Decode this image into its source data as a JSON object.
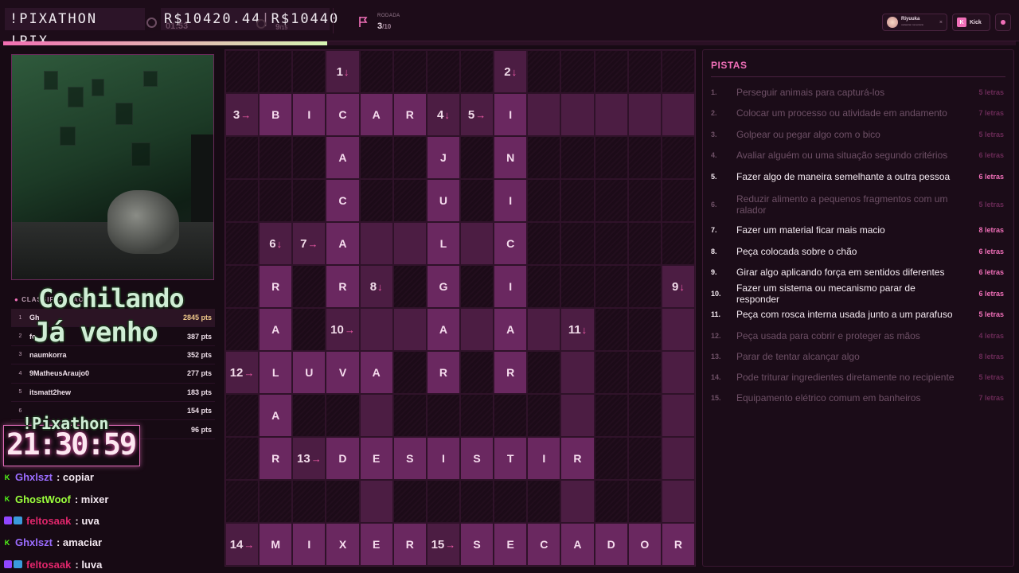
{
  "header": {
    "title": "!PIXATHON !PIX",
    "prize": "R$10420.44",
    "prize_separator": "|",
    "prize_goal": "R$10440",
    "timer": "01:53",
    "count": "9",
    "count_total": "/15",
    "round_label": "RODADA",
    "round_value": "3",
    "round_total": "/10",
    "progress": 0.32,
    "streamer_name": "Riyuuka",
    "streamer_sub": "cadastrar comentário",
    "platform_label": "Kick"
  },
  "webcam": {
    "status_line1": "Cochilando",
    "status_line2": "Já venho"
  },
  "leaderboard": {
    "title": "CLASSIFICAÇÃO",
    "rows": [
      {
        "rank": "1",
        "name": "Gh",
        "points": "2845 pts"
      },
      {
        "rank": "2",
        "name": "fe",
        "points": "387 pts"
      },
      {
        "rank": "3",
        "name": "naumkorra",
        "points": "352 pts"
      },
      {
        "rank": "4",
        "name": "9MatheusAraujo0",
        "points": "277 pts"
      },
      {
        "rank": "5",
        "name": "itsmatt2hew",
        "points": "183 pts"
      },
      {
        "rank": "6",
        "name": "",
        "points": "154 pts"
      },
      {
        "rank": "7",
        "name": "",
        "points": "96 pts"
      }
    ]
  },
  "overlay": {
    "pix_label": "!Pixathon",
    "clock": "21:30:59"
  },
  "chat": [
    {
      "platform": "kick",
      "user": "Ghxlszt",
      "msg": ": copiar",
      "color": "#9b6cff"
    },
    {
      "platform": "kick",
      "user": "GhostWoof",
      "msg": ": mixer",
      "color": "#9bff3c"
    },
    {
      "platform": "twitch",
      "user": "feltosaak",
      "msg": ": uva",
      "color": "#e0266b"
    },
    {
      "platform": "kick",
      "user": "Ghxlszt",
      "msg": ": amaciar",
      "color": "#9b6cff"
    },
    {
      "platform": "twitch",
      "user": "feltosaak",
      "msg": ": luva",
      "color": "#e0266b"
    }
  ],
  "grid": {
    "cols": 14,
    "rows": 12,
    "cells": [
      {
        "r": 0,
        "c": 3,
        "t": "num",
        "n": "1",
        "d": "↓"
      },
      {
        "r": 0,
        "c": 8,
        "t": "num",
        "n": "2",
        "d": "↓"
      },
      {
        "r": 1,
        "c": 0,
        "t": "num",
        "n": "3",
        "d": "→"
      },
      {
        "r": 1,
        "c": 1,
        "t": "letter",
        "v": "B"
      },
      {
        "r": 1,
        "c": 2,
        "t": "letter",
        "v": "I"
      },
      {
        "r": 1,
        "c": 3,
        "t": "letter",
        "v": "C"
      },
      {
        "r": 1,
        "c": 4,
        "t": "letter",
        "v": "A"
      },
      {
        "r": 1,
        "c": 5,
        "t": "letter",
        "v": "R"
      },
      {
        "r": 1,
        "c": 6,
        "t": "num",
        "n": "4",
        "d": "↓"
      },
      {
        "r": 1,
        "c": 7,
        "t": "num",
        "n": "5",
        "d": "→"
      },
      {
        "r": 1,
        "c": 8,
        "t": "letter",
        "v": "I"
      },
      {
        "r": 1,
        "c": 9,
        "t": "open"
      },
      {
        "r": 1,
        "c": 10,
        "t": "open"
      },
      {
        "r": 1,
        "c": 11,
        "t": "open"
      },
      {
        "r": 1,
        "c": 12,
        "t": "open"
      },
      {
        "r": 1,
        "c": 13,
        "t": "open"
      },
      {
        "r": 2,
        "c": 3,
        "t": "letter",
        "v": "A"
      },
      {
        "r": 2,
        "c": 6,
        "t": "letter",
        "v": "J"
      },
      {
        "r": 2,
        "c": 8,
        "t": "letter",
        "v": "N"
      },
      {
        "r": 3,
        "c": 3,
        "t": "letter",
        "v": "C"
      },
      {
        "r": 3,
        "c": 6,
        "t": "letter",
        "v": "U"
      },
      {
        "r": 3,
        "c": 8,
        "t": "letter",
        "v": "I"
      },
      {
        "r": 4,
        "c": 1,
        "t": "num",
        "n": "6",
        "d": "↓"
      },
      {
        "r": 4,
        "c": 2,
        "t": "num",
        "n": "7",
        "d": "→"
      },
      {
        "r": 4,
        "c": 3,
        "t": "letter",
        "v": "A"
      },
      {
        "r": 4,
        "c": 4,
        "t": "open"
      },
      {
        "r": 4,
        "c": 5,
        "t": "open"
      },
      {
        "r": 4,
        "c": 6,
        "t": "letter",
        "v": "L"
      },
      {
        "r": 4,
        "c": 7,
        "t": "open"
      },
      {
        "r": 4,
        "c": 8,
        "t": "letter",
        "v": "C"
      },
      {
        "r": 5,
        "c": 1,
        "t": "letter",
        "v": "R"
      },
      {
        "r": 5,
        "c": 3,
        "t": "letter",
        "v": "R"
      },
      {
        "r": 5,
        "c": 4,
        "t": "num",
        "n": "8",
        "d": "↓"
      },
      {
        "r": 5,
        "c": 6,
        "t": "letter",
        "v": "G"
      },
      {
        "r": 5,
        "c": 8,
        "t": "letter",
        "v": "I"
      },
      {
        "r": 5,
        "c": 13,
        "t": "num",
        "n": "9",
        "d": "↓"
      },
      {
        "r": 6,
        "c": 1,
        "t": "letter",
        "v": "A"
      },
      {
        "r": 6,
        "c": 3,
        "t": "num",
        "n": "10",
        "d": "→"
      },
      {
        "r": 6,
        "c": 4,
        "t": "open"
      },
      {
        "r": 6,
        "c": 5,
        "t": "open"
      },
      {
        "r": 6,
        "c": 6,
        "t": "letter",
        "v": "A"
      },
      {
        "r": 6,
        "c": 7,
        "t": "open"
      },
      {
        "r": 6,
        "c": 8,
        "t": "letter",
        "v": "A"
      },
      {
        "r": 6,
        "c": 9,
        "t": "open"
      },
      {
        "r": 6,
        "c": 10,
        "t": "num",
        "n": "11",
        "d": "↓"
      },
      {
        "r": 6,
        "c": 13,
        "t": "open"
      },
      {
        "r": 7,
        "c": 0,
        "t": "num",
        "n": "12",
        "d": "→"
      },
      {
        "r": 7,
        "c": 1,
        "t": "letter",
        "v": "L"
      },
      {
        "r": 7,
        "c": 2,
        "t": "letter",
        "v": "U"
      },
      {
        "r": 7,
        "c": 3,
        "t": "letter",
        "v": "V"
      },
      {
        "r": 7,
        "c": 4,
        "t": "letter",
        "v": "A"
      },
      {
        "r": 7,
        "c": 6,
        "t": "letter",
        "v": "R"
      },
      {
        "r": 7,
        "c": 8,
        "t": "letter",
        "v": "R"
      },
      {
        "r": 7,
        "c": 10,
        "t": "open"
      },
      {
        "r": 7,
        "c": 13,
        "t": "open"
      },
      {
        "r": 8,
        "c": 1,
        "t": "letter",
        "v": "A"
      },
      {
        "r": 8,
        "c": 4,
        "t": "open"
      },
      {
        "r": 8,
        "c": 10,
        "t": "open"
      },
      {
        "r": 8,
        "c": 13,
        "t": "open"
      },
      {
        "r": 9,
        "c": 1,
        "t": "letter",
        "v": "R"
      },
      {
        "r": 9,
        "c": 2,
        "t": "num",
        "n": "13",
        "d": "→"
      },
      {
        "r": 9,
        "c": 3,
        "t": "letter",
        "v": "D"
      },
      {
        "r": 9,
        "c": 4,
        "t": "letter",
        "v": "E"
      },
      {
        "r": 9,
        "c": 5,
        "t": "letter",
        "v": "S"
      },
      {
        "r": 9,
        "c": 6,
        "t": "letter",
        "v": "I"
      },
      {
        "r": 9,
        "c": 7,
        "t": "letter",
        "v": "S"
      },
      {
        "r": 9,
        "c": 8,
        "t": "letter",
        "v": "T"
      },
      {
        "r": 9,
        "c": 9,
        "t": "letter",
        "v": "I"
      },
      {
        "r": 9,
        "c": 10,
        "t": "letter",
        "v": "R"
      },
      {
        "r": 9,
        "c": 13,
        "t": "open"
      },
      {
        "r": 10,
        "c": 4,
        "t": "open"
      },
      {
        "r": 10,
        "c": 10,
        "t": "open"
      },
      {
        "r": 10,
        "c": 13,
        "t": "open"
      },
      {
        "r": 11,
        "c": 0,
        "t": "num",
        "n": "14",
        "d": "→"
      },
      {
        "r": 11,
        "c": 1,
        "t": "letter",
        "v": "M"
      },
      {
        "r": 11,
        "c": 2,
        "t": "letter",
        "v": "I"
      },
      {
        "r": 11,
        "c": 3,
        "t": "letter",
        "v": "X"
      },
      {
        "r": 11,
        "c": 4,
        "t": "letter",
        "v": "E"
      },
      {
        "r": 11,
        "c": 5,
        "t": "letter",
        "v": "R"
      },
      {
        "r": 11,
        "c": 6,
        "t": "num",
        "n": "15",
        "d": "→"
      },
      {
        "r": 11,
        "c": 7,
        "t": "letter",
        "v": "S"
      },
      {
        "r": 11,
        "c": 8,
        "t": "letter",
        "v": "E"
      },
      {
        "r": 11,
        "c": 9,
        "t": "letter",
        "v": "C"
      },
      {
        "r": 11,
        "c": 10,
        "t": "letter",
        "v": "A"
      },
      {
        "r": 11,
        "c": 11,
        "t": "letter",
        "v": "D"
      },
      {
        "r": 11,
        "c": 12,
        "t": "letter",
        "v": "O"
      },
      {
        "r": 11,
        "c": 13,
        "t": "letter",
        "v": "R"
      }
    ]
  },
  "clues": {
    "title": "PISTAS",
    "items": [
      {
        "n": "1.",
        "text": "Perseguir animais para capturá-los",
        "letters": "5 letras",
        "state": "dim"
      },
      {
        "n": "2.",
        "text": "Colocar um processo ou atividade em andamento",
        "letters": "7 letras",
        "state": "dim"
      },
      {
        "n": "3.",
        "text": "Golpear ou pegar algo com o bico",
        "letters": "5 letras",
        "state": "dim"
      },
      {
        "n": "4.",
        "text": "Avaliar alguém ou uma situação segundo critérios",
        "letters": "6 letras",
        "state": "dim"
      },
      {
        "n": "5.",
        "text": "Fazer algo de maneira semelhante a outra pessoa",
        "letters": "6 letras",
        "state": "on"
      },
      {
        "n": "6.",
        "text": "Reduzir alimento a pequenos fragmentos com um ralador",
        "letters": "5 letras",
        "state": "dim"
      },
      {
        "n": "7.",
        "text": "Fazer um material ficar mais macio",
        "letters": "8 letras",
        "state": "on"
      },
      {
        "n": "8.",
        "text": "Peça colocada sobre o chão",
        "letters": "6 letras",
        "state": "on"
      },
      {
        "n": "9.",
        "text": "Girar algo aplicando força em sentidos diferentes",
        "letters": "6 letras",
        "state": "on"
      },
      {
        "n": "10.",
        "text": "Fazer um sistema ou mecanismo parar de responder",
        "letters": "6 letras",
        "state": "on"
      },
      {
        "n": "11.",
        "text": "Peça com rosca interna usada junto a um parafuso",
        "letters": "5 letras",
        "state": "on"
      },
      {
        "n": "12.",
        "text": "Peça usada para cobrir e proteger as mãos",
        "letters": "4 letras",
        "state": "dim"
      },
      {
        "n": "13.",
        "text": "Parar de tentar alcançar algo",
        "letters": "8 letras",
        "state": "dim"
      },
      {
        "n": "14.",
        "text": "Pode triturar ingredientes diretamente no recipiente",
        "letters": "5 letras",
        "state": "dim"
      },
      {
        "n": "15.",
        "text": "Equipamento elétrico comum em banheiros",
        "letters": "7 letras",
        "state": "dim"
      }
    ]
  },
  "colors": {
    "accent": "#f06fb8",
    "background": "#170a14",
    "letter_cell": "#6a2860",
    "open_cell": "#4c1d43"
  }
}
